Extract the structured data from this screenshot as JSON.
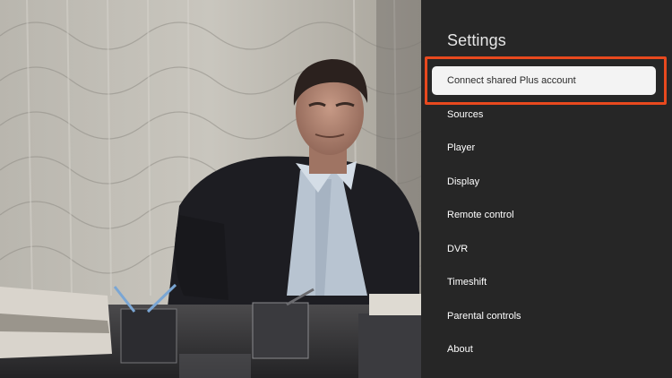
{
  "settings": {
    "title": "Settings",
    "items": [
      {
        "label": "Connect shared Plus account",
        "selected": true
      },
      {
        "label": "Sources"
      },
      {
        "label": "Player"
      },
      {
        "label": "Display"
      },
      {
        "label": "Remote control"
      },
      {
        "label": "DVR"
      },
      {
        "label": "Timeshift"
      },
      {
        "label": "Parental controls"
      },
      {
        "label": "About"
      }
    ]
  },
  "colors": {
    "panel_background": "#262626",
    "selected_item_background": "#f3f3f3",
    "highlight_border": "#e8491e"
  },
  "video": {
    "content": "vintage-tv-still-man-in-suit-at-desk"
  }
}
